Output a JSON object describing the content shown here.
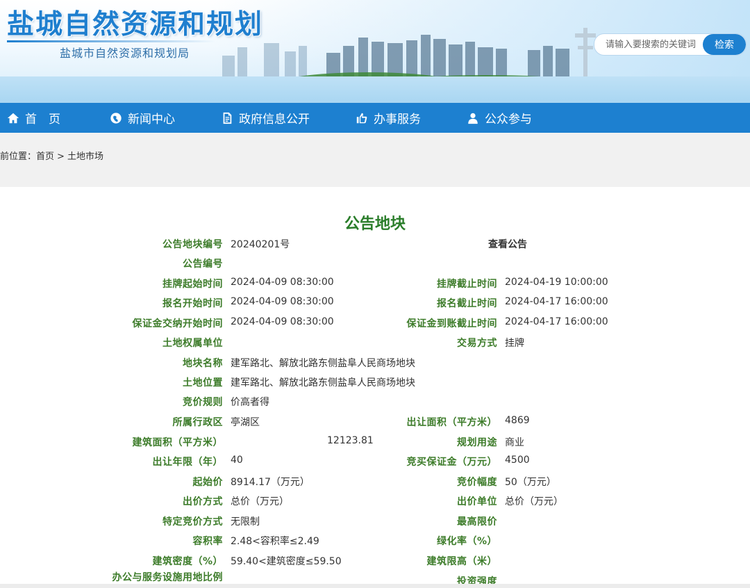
{
  "header": {
    "site_title": "盐城自然资源和规划",
    "site_subtitle": "盐城市自然资源和规划局",
    "search_placeholder": "请输入要搜索的关键词",
    "search_button": "检索"
  },
  "nav": [
    {
      "label": "首　页",
      "icon": "home-icon"
    },
    {
      "label": "新闻中心",
      "icon": "globe-icon"
    },
    {
      "label": "政府信息公开",
      "icon": "document-icon"
    },
    {
      "label": "办事服务",
      "icon": "thumbs-up-icon"
    },
    {
      "label": "公众参与",
      "icon": "user-icon"
    }
  ],
  "breadcrumb": {
    "prefix": "前位置：",
    "home": "首页",
    "separator": ">",
    "current": "土地市场"
  },
  "notice": {
    "title": "公告地块",
    "view_link": "查看公告",
    "rows": [
      {
        "left_label": "公告地块编号",
        "left_value": "20240201号",
        "right_label": "",
        "right_value": ""
      },
      {
        "left_label": "公告编号",
        "left_value": "",
        "right_label": "",
        "right_value": ""
      },
      {
        "left_label": "挂牌起始时间",
        "left_value": "2024-04-09 08:30:00",
        "right_label": "挂牌截止时间",
        "right_value": "2024-04-19 10:00:00"
      },
      {
        "left_label": "报名开始时间",
        "left_value": "2024-04-09 08:30:00",
        "right_label": "报名截止时间",
        "right_value": "2024-04-17 16:00:00"
      },
      {
        "left_label": "保证金交纳开始时间",
        "left_value": "2024-04-09 08:30:00",
        "right_label": "保证金到账截止时间",
        "right_value": "2024-04-17 16:00:00"
      },
      {
        "left_label": "土地权属单位",
        "left_value": "",
        "right_label": "交易方式",
        "right_value": "挂牌"
      },
      {
        "left_label": "地块名称",
        "left_value": "建军路北、解放北路东侧盐阜人民商场地块",
        "right_label": "",
        "right_value": ""
      },
      {
        "left_label": "土地位置",
        "left_value": "建军路北、解放北路东侧盐阜人民商场地块",
        "right_label": "",
        "right_value": ""
      },
      {
        "left_label": "竞价规则",
        "left_value": "价高者得",
        "right_label": "",
        "right_value": ""
      },
      {
        "left_label": "所属行政区",
        "left_value": "亭湖区",
        "right_label": "出让面积（平方米）",
        "right_value": "4869"
      },
      {
        "left_label": "建筑面积（平方米）",
        "left_value": "12123.81",
        "right_label": "规划用途",
        "right_value": "商业"
      },
      {
        "left_label": "出让年限（年）",
        "left_value": "40",
        "right_label": "竞买保证金（万元）",
        "right_value": "4500"
      },
      {
        "left_label": "起始价",
        "left_value": "8914.17（万元）",
        "right_label": "竞价幅度",
        "right_value": "50（万元）"
      },
      {
        "left_label": "出价方式",
        "left_value": "总价（万元）",
        "right_label": "出价单位",
        "right_value": "总价（万元）"
      },
      {
        "left_label": "特定竞价方式",
        "left_value": "无限制",
        "right_label": "最高限价",
        "right_value": ""
      },
      {
        "left_label": "容积率",
        "left_value": "2.48<容积率≤2.49",
        "right_label": "绿化率（%）",
        "right_value": ""
      },
      {
        "left_label": "建筑密度（%）",
        "left_value": "59.40<建筑密度≤59.50",
        "right_label": "建筑限高（米）",
        "right_value": ""
      },
      {
        "left_label": "办公与服务设施用地比例",
        "left_value": "",
        "right_label": "投资强度",
        "right_value": ""
      }
    ]
  },
  "colors": {
    "nav_bg": "#1d80d0",
    "label_green": "#3d7c2a",
    "title_green": "#2a7d2a",
    "site_title_blue": "#1f7fcf"
  }
}
